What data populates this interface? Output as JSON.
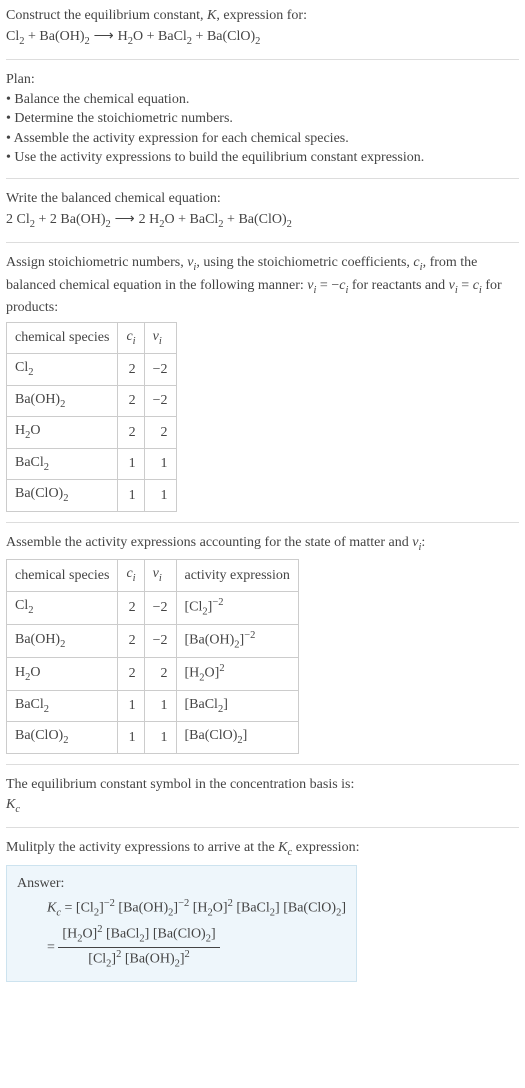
{
  "intro": {
    "line1_prefix": "Construct the equilibrium constant, ",
    "line1_K": "K",
    "line1_suffix": ", expression for:",
    "eq_lhs_1": "Cl",
    "eq_lhs_1_sub": "2",
    "plus": " + ",
    "eq_lhs_2": "Ba(OH)",
    "eq_lhs_2_sub": "2",
    "arrow": " ⟶ ",
    "eq_rhs_1": "H",
    "eq_rhs_1_sub": "2",
    "eq_rhs_1b": "O",
    "eq_rhs_2": "BaCl",
    "eq_rhs_2_sub": "2",
    "eq_rhs_3": "Ba(ClO)",
    "eq_rhs_3_sub": "2"
  },
  "plan": {
    "heading": "Plan:",
    "b1": "• Balance the chemical equation.",
    "b2": "• Determine the stoichiometric numbers.",
    "b3": "• Assemble the activity expression for each chemical species.",
    "b4": "• Use the activity expressions to build the equilibrium constant expression."
  },
  "balanced": {
    "heading": "Write the balanced chemical equation:",
    "c1": "2 ",
    "s1": "Cl",
    "s1_sub": "2",
    "c2": "2 ",
    "s2": "Ba(OH)",
    "s2_sub": "2",
    "c3": "2 ",
    "s3": "H",
    "s3_sub": "2",
    "s3b": "O",
    "s4": "BaCl",
    "s4_sub": "2",
    "s5": "Ba(ClO)",
    "s5_sub": "2"
  },
  "assign": {
    "part1": "Assign stoichiometric numbers, ",
    "nu": "ν",
    "nu_sub": "i",
    "part2": ", using the stoichiometric coefficients, ",
    "c": "c",
    "c_sub": "i",
    "part3": ", from the balanced chemical equation in the following manner: ",
    "eq1_lhs": "ν",
    "eq1_lhs_sub": "i",
    "eq1_mid": " = −",
    "eq1_rhs": "c",
    "eq1_rhs_sub": "i",
    "part4": " for reactants and ",
    "eq2_lhs": "ν",
    "eq2_lhs_sub": "i",
    "eq2_mid": " = ",
    "eq2_rhs": "c",
    "eq2_rhs_sub": "i",
    "part5": " for products:"
  },
  "table1": {
    "h1": "chemical species",
    "h2": "c",
    "h2_sub": "i",
    "h3": "ν",
    "h3_sub": "i",
    "r1": {
      "sp": "Cl",
      "sp_sub": "2",
      "c": "2",
      "n": "−2"
    },
    "r2": {
      "sp": "Ba(OH)",
      "sp_sub": "2",
      "c": "2",
      "n": "−2"
    },
    "r3": {
      "sp": "H",
      "sp_sub": "2",
      "sp_b": "O",
      "c": "2",
      "n": "2"
    },
    "r4": {
      "sp": "BaCl",
      "sp_sub": "2",
      "c": "1",
      "n": "1"
    },
    "r5": {
      "sp": "Ba(ClO)",
      "sp_sub": "2",
      "c": "1",
      "n": "1"
    }
  },
  "assemble": {
    "part1": "Assemble the activity expressions accounting for the state of matter and ",
    "nu": "ν",
    "nu_sub": "i",
    "part2": ":"
  },
  "table2": {
    "h1": "chemical species",
    "h2": "c",
    "h2_sub": "i",
    "h3": "ν",
    "h3_sub": "i",
    "h4": "activity expression",
    "r1": {
      "sp": "Cl",
      "sp_sub": "2",
      "c": "2",
      "n": "−2",
      "ae_l": "[Cl",
      "ae_sub": "2",
      "ae_r": "]",
      "ae_exp": "−2"
    },
    "r2": {
      "sp": "Ba(OH)",
      "sp_sub": "2",
      "c": "2",
      "n": "−2",
      "ae_l": "[Ba(OH)",
      "ae_sub": "2",
      "ae_r": "]",
      "ae_exp": "−2"
    },
    "r3": {
      "sp": "H",
      "sp_sub": "2",
      "sp_b": "O",
      "c": "2",
      "n": "2",
      "ae_l": "[H",
      "ae_sub": "2",
      "ae_r": "O]",
      "ae_exp": "2"
    },
    "r4": {
      "sp": "BaCl",
      "sp_sub": "2",
      "c": "1",
      "n": "1",
      "ae_l": "[BaCl",
      "ae_sub": "2",
      "ae_r": "]",
      "ae_exp": ""
    },
    "r5": {
      "sp": "Ba(ClO)",
      "sp_sub": "2",
      "c": "1",
      "n": "1",
      "ae_l": "[Ba(ClO)",
      "ae_sub": "2",
      "ae_r": "]",
      "ae_exp": ""
    }
  },
  "symbol": {
    "line1": "The equilibrium constant symbol in the concentration basis is:",
    "K": "K",
    "K_sub": "c"
  },
  "multiply": {
    "part1": "Mulitply the activity expressions to arrive at the ",
    "K": "K",
    "K_sub": "c",
    "part2": " expression:"
  },
  "answer": {
    "label": "Answer:",
    "K": "K",
    "K_sub": "c",
    "eq": " = ",
    "t1": "[Cl",
    "t1s": "2",
    "t1r": "]",
    "t1e": "−2",
    "t2": " [Ba(OH)",
    "t2s": "2",
    "t2r": "]",
    "t2e": "−2",
    "t3": " [H",
    "t3s": "2",
    "t3r": "O]",
    "t3e": "2",
    "t4": " [BaCl",
    "t4s": "2",
    "t4r": "]",
    "t5": " [Ba(ClO)",
    "t5s": "2",
    "t5r": "]",
    "eq2": "= ",
    "num1": "[H",
    "num1s": "2",
    "num1r": "O]",
    "num1e": "2",
    "num2": " [BaCl",
    "num2s": "2",
    "num2r": "]",
    "num3": " [Ba(ClO)",
    "num3s": "2",
    "num3r": "]",
    "den1": "[Cl",
    "den1s": "2",
    "den1r": "]",
    "den1e": "2",
    "den2": " [Ba(OH)",
    "den2s": "2",
    "den2r": "]",
    "den2e": "2"
  }
}
